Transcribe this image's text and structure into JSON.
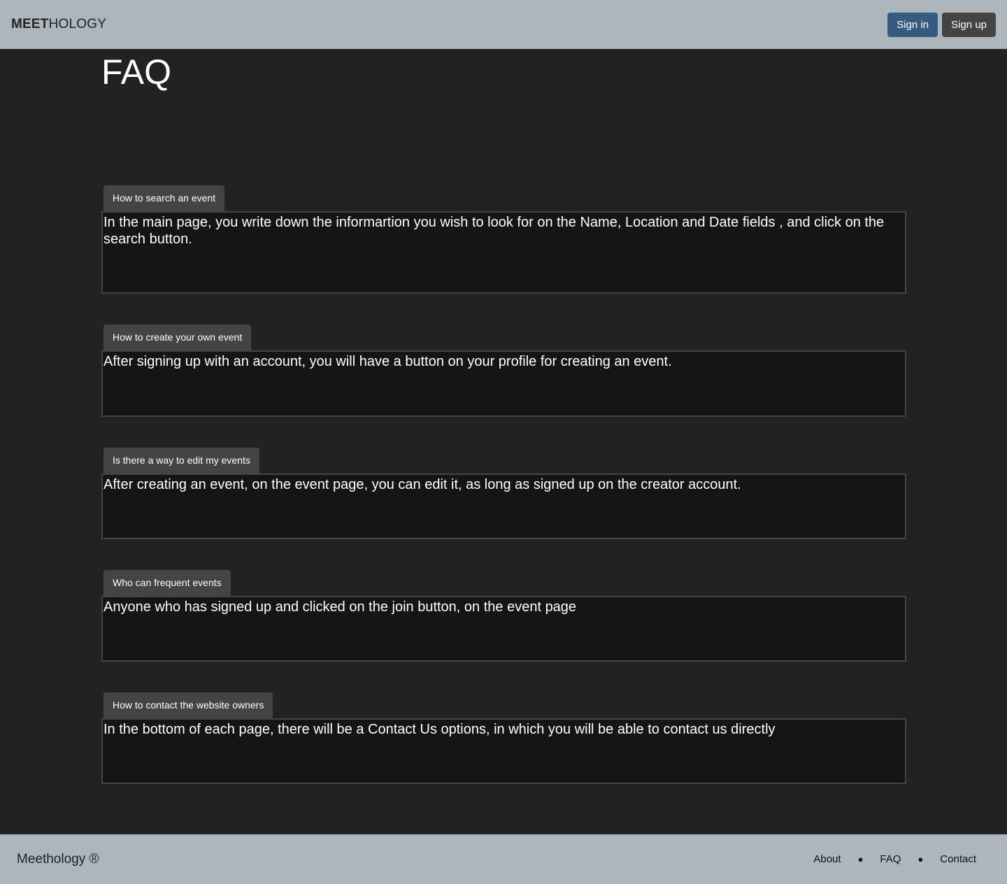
{
  "header": {
    "brand_bold": "MEET",
    "brand_rest": "HOLOGY",
    "signin_label": "Sign in",
    "signup_label": "Sign up"
  },
  "main": {
    "title": "FAQ",
    "faqs": [
      {
        "question": "How to search an event",
        "answer": "In the main page, you write down the informartion you wish to look for on the Name, Location and Date fields , and click on the search button."
      },
      {
        "question": "How to create your own event",
        "answer": "After signing up with an account, you will have a button on your profile for creating an event."
      },
      {
        "question": "Is there a way to edit my events",
        "answer": "After creating an event, on the event page, you can edit it, as long as signed up on the creator account."
      },
      {
        "question": "Who can frequent events",
        "answer": "Anyone who has signed up and clicked on the join button, on the event page"
      },
      {
        "question": "How to contact the website owners",
        "answer": "In the bottom of each page, there will be a Contact Us options, in which you will be able to contact us directly"
      }
    ]
  },
  "footer": {
    "brand": "Meethology ®",
    "links": [
      "About",
      "FAQ",
      "Contact"
    ],
    "separator": "●"
  },
  "colors": {
    "header_bg": "#adb5bd",
    "page_bg": "#222222",
    "signin_bg": "#375a7f",
    "signup_bg": "#444444",
    "answer_bg": "#151515"
  }
}
